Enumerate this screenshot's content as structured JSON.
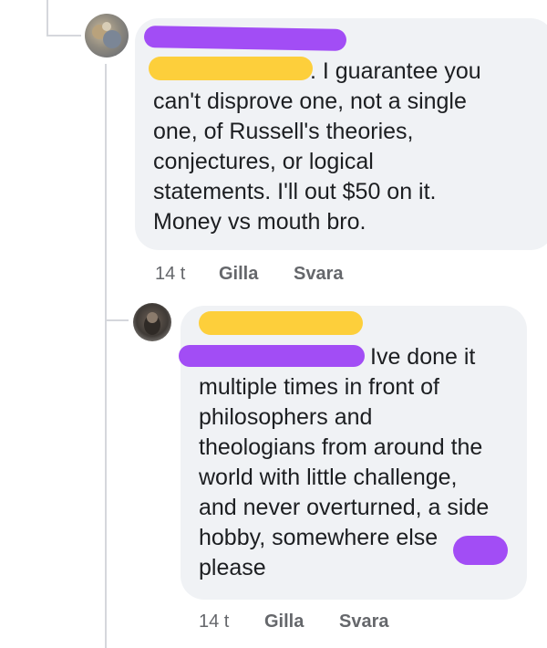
{
  "comments": [
    {
      "text": ". I guarantee you\ncan't disprove one, not a single\none, of Russell's theories,\nconjectures, or logical\nstatements. I'll out $50 on it.\nMoney vs mouth bro.",
      "timestamp": "14 t",
      "like_label": "Gilla",
      "reply_label": "Svara"
    },
    {
      "text": "Ive done it\nmultiple times in front of\nphilosophers and\ntheologians from around the\nworld with little challenge,\nand never overturned, a side\nhobby, somewhere else\nplease",
      "timestamp": "14 t",
      "like_label": "Gilla",
      "reply_label": "Svara"
    }
  ],
  "colors": {
    "bubble": "#f0f2f5",
    "redact_purple": "#a24df5",
    "redact_yellow": "#fdcf3b",
    "meta_text": "#65676b"
  }
}
